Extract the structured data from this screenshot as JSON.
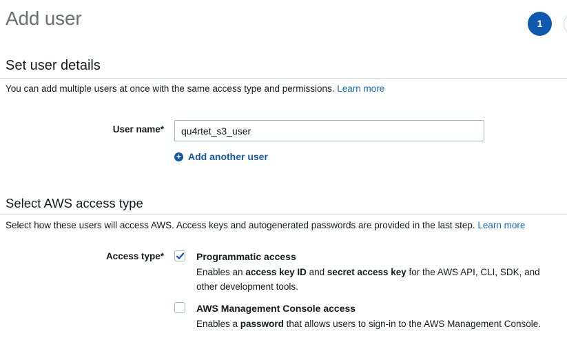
{
  "page": {
    "title": "Add user"
  },
  "steps": {
    "current": "1"
  },
  "user_details": {
    "heading": "Set user details",
    "description": "You can add multiple users at once with the same access type and permissions.",
    "learn_more": "Learn more",
    "user_name_label": "User name*",
    "user_name_value": "qu4rtet_s3_user",
    "add_another": "Add another user"
  },
  "access_type": {
    "heading": "Select AWS access type",
    "description": "Select how these users will access AWS. Access keys and autogenerated passwords are provided in the last step.",
    "learn_more": "Learn more",
    "label": "Access type*",
    "options": [
      {
        "title": "Programmatic access",
        "checked": true,
        "desc_1": "Enables an ",
        "desc_b1": "access key ID",
        "desc_2": " and ",
        "desc_b2": "secret access key",
        "desc_3": " for the AWS API, CLI, SDK, and other development tools."
      },
      {
        "title": "AWS Management Console access",
        "checked": false,
        "desc_1": "Enables a ",
        "desc_b1": "password",
        "desc_2": " that allows users to sign-in to the AWS Management Console."
      }
    ]
  },
  "colors": {
    "accent": "#0f5aaf",
    "link": "#0f6dbf"
  }
}
